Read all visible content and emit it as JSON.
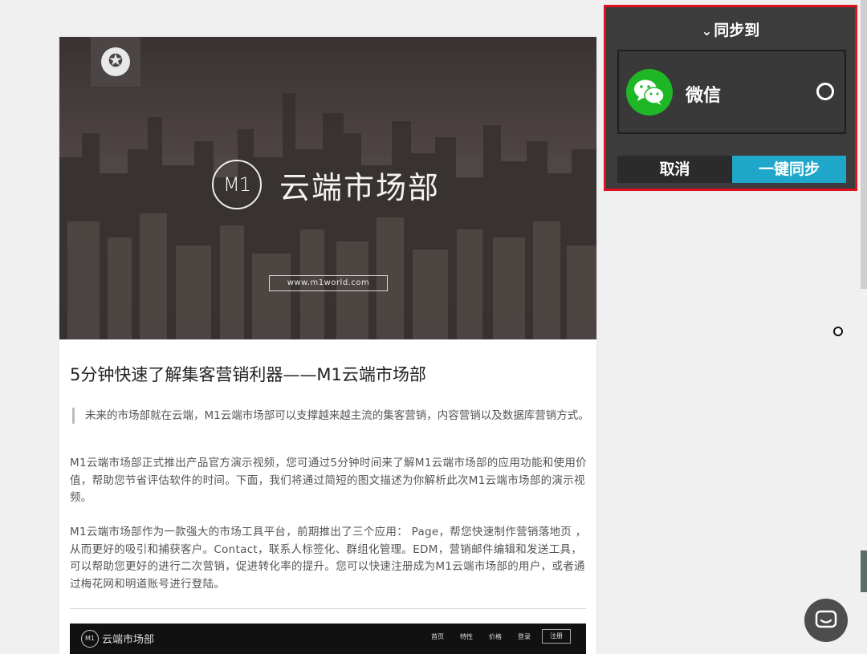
{
  "article": {
    "hero": {
      "brand_mark": "M1",
      "brand_name": "云端市场部",
      "url": "www.m1world.com"
    },
    "title": "5分钟快速了解集客营销利器——M1云端市场部",
    "quote": "未来的市场部就在云端，M1云端市场部可以支撑越来越主流的集客营销，内容营销以及数据库营销方式。",
    "paragraphs": [
      "M1云端市场部正式推出产品官方演示视频，您可通过5分钟时间来了解M1云端市场部的应用功能和使用价值，帮助您节省评估软件的时间。下面，我们将通过简短的图文描述为你解析此次M1云端市场部的演示视频。",
      "M1云端市场部作为一款强大的市场工具平台，前期推出了三个应用： Page，帮您快速制作营销落地页 ，从而更好的吸引和捕获客户。Contact，联系人标签化、群组化管理。EDM，营销邮件编辑和发送工具，可以帮助您更好的进行二次营销，促进转化率的提升。您可以快速注册成为M1云端市场部的用户，或者通过梅花网和明道账号进行登陆。"
    ],
    "screenshot": {
      "logo": "M1",
      "name": "云端市场部",
      "nav": [
        "首页",
        "特性",
        "价格",
        "登录"
      ],
      "register": "注册"
    }
  },
  "sync_panel": {
    "header": "同步到",
    "chevron_icon": "chevron-down-icon",
    "target": {
      "label": "微信",
      "icon": "wechat-icon",
      "selected": false
    },
    "cancel_label": "取消",
    "sync_label": "一键同步",
    "colors": {
      "border": "#e0101f",
      "accent": "#1ea7c9",
      "wechat": "#1fb725"
    }
  },
  "floating": {
    "chat_icon": "chat-bubble-icon"
  }
}
